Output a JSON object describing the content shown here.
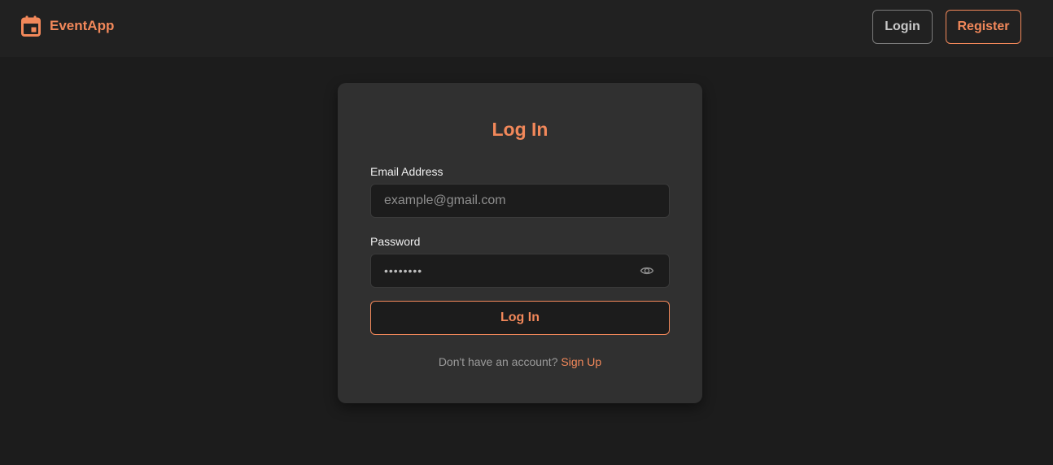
{
  "colors": {
    "accent": "#f2885a",
    "page_background": "#1c1c1c",
    "topbar_background": "#212121",
    "card_background": "#303030",
    "input_background": "#1c1c1c"
  },
  "brand": {
    "name": "EventApp",
    "icon": "calendar-icon"
  },
  "nav": {
    "login_label": "Login",
    "register_label": "Register"
  },
  "login_form": {
    "title": "Log In",
    "email": {
      "label": "Email Address",
      "value": "",
      "placeholder": "example@gmail.com"
    },
    "password": {
      "label": "Password",
      "masked_value": "••••••••",
      "toggle_icon": "eye-icon"
    },
    "submit_label": "Log In",
    "signup_prompt": "Don't have an account? ",
    "signup_link": "Sign Up"
  }
}
